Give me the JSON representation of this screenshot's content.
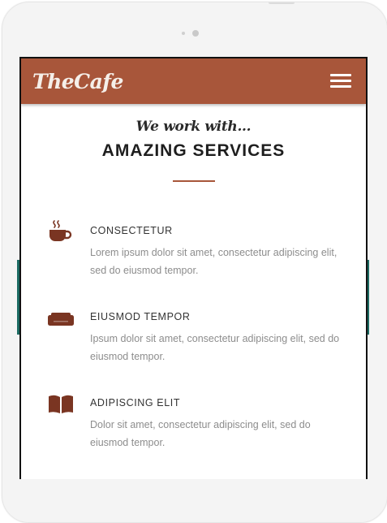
{
  "navbar": {
    "brand": "TheCafe",
    "menu_icon": "hamburger-menu-icon"
  },
  "section": {
    "eyebrow": "We work with...",
    "heading": "AMAZING SERVICES"
  },
  "services": [
    {
      "icon": "coffee-cup-icon",
      "title": "CONSECTETUR",
      "description": "Lorem ipsum dolor sit amet, consectetur adipiscing elit, sed do eiusmod tempor."
    },
    {
      "icon": "sofa-icon",
      "title": "EIUSMOD TEMPOR",
      "description": "Ipsum dolor sit amet, consectetur adipiscing elit, sed do eiusmod tempor."
    },
    {
      "icon": "open-book-icon",
      "title": "ADIPISCING ELIT",
      "description": "Dolor sit amet, consectetur adipiscing elit, sed do eiusmod tempor."
    }
  ],
  "colors": {
    "accent": "#a8563a",
    "icon": "#7a3522",
    "heading": "#1e1e1e",
    "body_text": "#8d8d8d"
  }
}
